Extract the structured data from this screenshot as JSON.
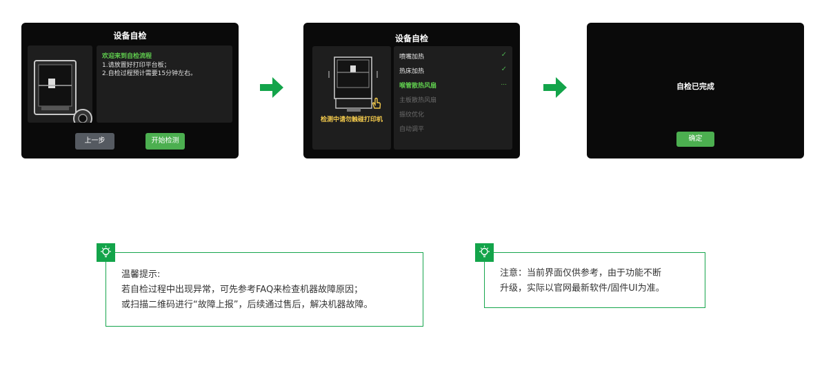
{
  "screen1": {
    "title": "设备自检",
    "welcome_heading": "欢迎来到自检流程",
    "lines": [
      "1.请放置好打印平台板；",
      "2.自检过程预计需要15分钟左右。"
    ],
    "back_button": "上一步",
    "start_button": "开始检测"
  },
  "screen2": {
    "title": "设备自检",
    "touch_warning": "检测中请勿触碰打印机",
    "checklist": [
      {
        "label": "喷嘴加热",
        "status": "done"
      },
      {
        "label": "热床加热",
        "status": "done"
      },
      {
        "label": "喉管散热风扇",
        "status": "in-progress",
        "indicator": "..."
      },
      {
        "label": "主板散热风扇",
        "status": "pending"
      },
      {
        "label": "振纹优化",
        "status": "pending"
      },
      {
        "label": "自动调平",
        "status": "pending"
      }
    ]
  },
  "screen3": {
    "message": "自检已完成",
    "confirm_button": "确定"
  },
  "tip1": {
    "heading": "温馨提示:",
    "lines": [
      "若自检过程中出现异常，可先参考FAQ来检查机器故障原因；",
      "或扫描二维码进行“故障上报”，后续通过售后，解决机器故障。"
    ]
  },
  "tip2": {
    "lines": [
      "注意：当前界面仅供参考，由于功能不断",
      "升级，实际以官网最新软件/固件UI为准。"
    ]
  },
  "colors": {
    "brand_green": "#13a44a",
    "ui_green": "#4caf50",
    "highlight_green": "#5ec94d",
    "warning_yellow": "#f2c94c",
    "screen_bg": "#0a0a0a"
  },
  "icons": [
    "printer-illustration",
    "arrow-right-icon",
    "check-icon",
    "hand-touch-icon",
    "lightbulb-icon"
  ]
}
